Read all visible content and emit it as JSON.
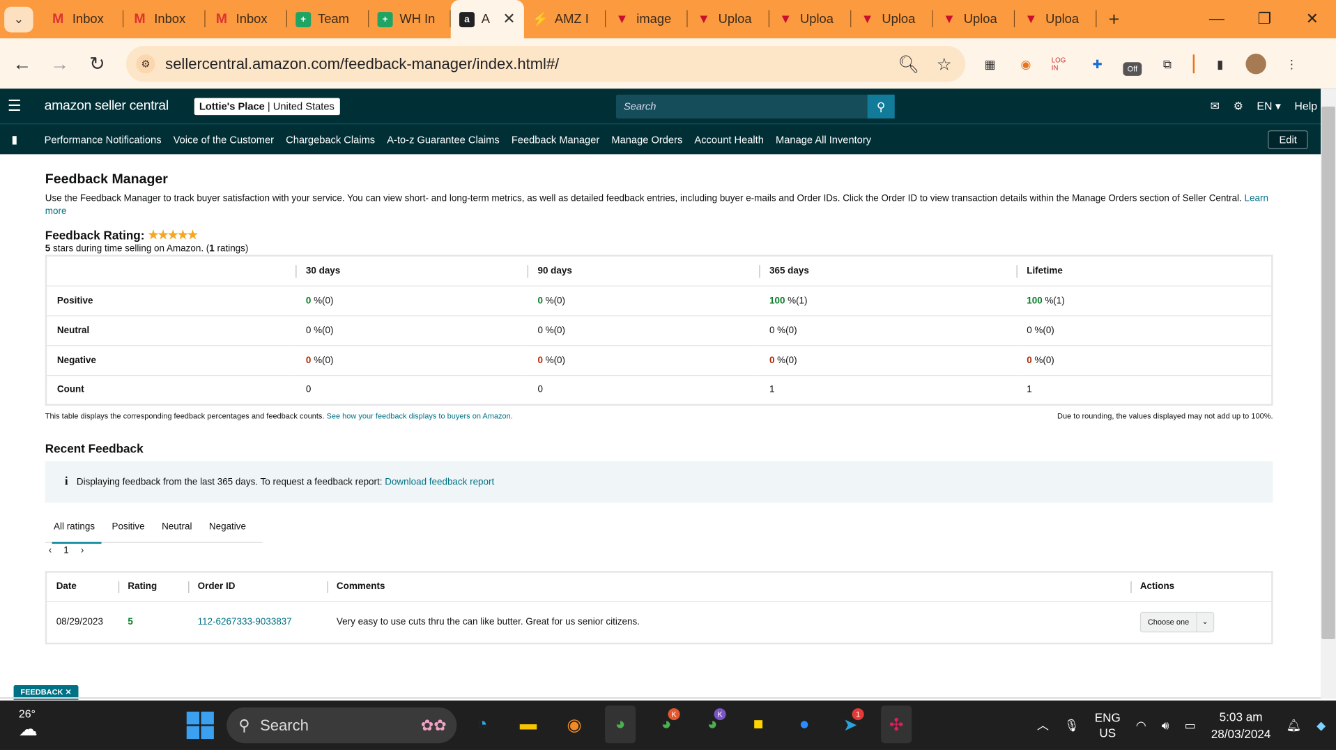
{
  "browser": {
    "tabs": [
      {
        "label": "Inbox",
        "icon": "gmail-icon"
      },
      {
        "label": "Inbox",
        "icon": "gmail-icon"
      },
      {
        "label": "Inbox",
        "icon": "gmail-icon"
      },
      {
        "label": "Team",
        "icon": "sheets-icon"
      },
      {
        "label": "WH In",
        "icon": "sheets-icon"
      },
      {
        "label": "A",
        "icon": "amazon-icon",
        "active": true
      },
      {
        "label": "AMZ I",
        "icon": "amz-tool-icon"
      },
      {
        "label": "image",
        "icon": "upload-icon"
      },
      {
        "label": "Uploa",
        "icon": "upload-icon"
      },
      {
        "label": "Uploa",
        "icon": "upload-icon"
      },
      {
        "label": "Uploa",
        "icon": "upload-icon"
      },
      {
        "label": "Uploa",
        "icon": "upload-icon"
      },
      {
        "label": "Uploa",
        "icon": "upload-icon"
      }
    ],
    "url": "sellercentral.amazon.com/feedback-manager/index.html#/",
    "ext_off_label": "Off"
  },
  "header": {
    "logo_text": "amazon seller central",
    "store_name": "Lottie's Place",
    "store_region": "United States",
    "search_placeholder": "Search",
    "lang": "EN",
    "help": "Help"
  },
  "nav": {
    "items": [
      "Performance Notifications",
      "Voice of the Customer",
      "Chargeback Claims",
      "A-to-z Guarantee Claims",
      "Feedback Manager",
      "Manage Orders",
      "Account Health",
      "Manage All Inventory"
    ],
    "edit": "Edit"
  },
  "page": {
    "title": "Feedback Manager",
    "description": "Use the Feedback Manager to track buyer satisfaction with your service. You can view short- and long-term metrics, as well as detailed feedback entries, including buyer e-mails and Order IDs. Click the Order ID to view transaction details within the Manage Orders section of Seller Central.",
    "learn_more": "Learn more",
    "rating_label": "Feedback Rating:",
    "stars": 5,
    "rating_sub_a": "5",
    "rating_sub_b": " stars during time selling on Amazon. (",
    "rating_sub_c": "1",
    "rating_sub_d": " ratings)",
    "table": {
      "headers": [
        "",
        "30 days",
        "90 days",
        "365 days",
        "Lifetime"
      ],
      "rows": [
        {
          "label": "Positive",
          "cells": [
            [
              "0",
              "%(0)"
            ],
            [
              "0",
              "%(0)"
            ],
            [
              "100",
              "%(1)"
            ],
            [
              "100",
              "%(1)"
            ]
          ]
        },
        {
          "label": "Neutral",
          "cells": [
            [
              "0",
              "%(0)"
            ],
            [
              "0",
              "%(0)"
            ],
            [
              "0",
              "%(0)"
            ],
            [
              "0",
              "%(0)"
            ]
          ]
        },
        {
          "label": "Negative",
          "cells": [
            [
              "0",
              "%(0)"
            ],
            [
              "0",
              "%(0)"
            ],
            [
              "0",
              "%(0)"
            ],
            [
              "0",
              "%(0)"
            ]
          ]
        },
        {
          "label": "Count",
          "cells": [
            [
              "0",
              ""
            ],
            [
              "0",
              ""
            ],
            [
              "1",
              ""
            ],
            [
              "1",
              ""
            ]
          ]
        }
      ]
    },
    "table_note": "This table displays the corresponding feedback percentages and feedback counts.",
    "table_note_link": "See how your feedback displays to buyers on Amazon.",
    "rounding_note": "Due to rounding, the values displayed may not add up to 100%.",
    "recent_title": "Recent Feedback",
    "info_text": "Displaying feedback from the last 365 days. To request a feedback report:",
    "info_link": "Download feedback report",
    "filter_tabs": [
      "All ratings",
      "Positive",
      "Neutral",
      "Negative"
    ],
    "page_number": "1",
    "recent_headers": [
      "Date",
      "Rating",
      "Order ID",
      "Comments",
      "Actions"
    ],
    "recent_rows": [
      {
        "date": "08/29/2023",
        "rating": "5",
        "order_id": "112-6267333-9033837",
        "comment": "Very easy to use cuts thru the can like butter. Great for us senior citizens.",
        "action": "Choose one"
      }
    ],
    "feedback_tag": "FEEDBACK ✕"
  },
  "taskbar": {
    "temp": "26°",
    "search": "Search",
    "lang_top": "ENG",
    "lang_bottom": "US",
    "time": "5:03 am",
    "date": "28/03/2024",
    "telegram_badge": "1",
    "chrome_k1_badge": "K",
    "chrome_k2_badge": "K"
  },
  "colors": {
    "accent": "#007185",
    "header_bg": "#002f36",
    "positive": "#067d26",
    "negative": "#b12704",
    "tab_strip": "#fb9a3f"
  }
}
